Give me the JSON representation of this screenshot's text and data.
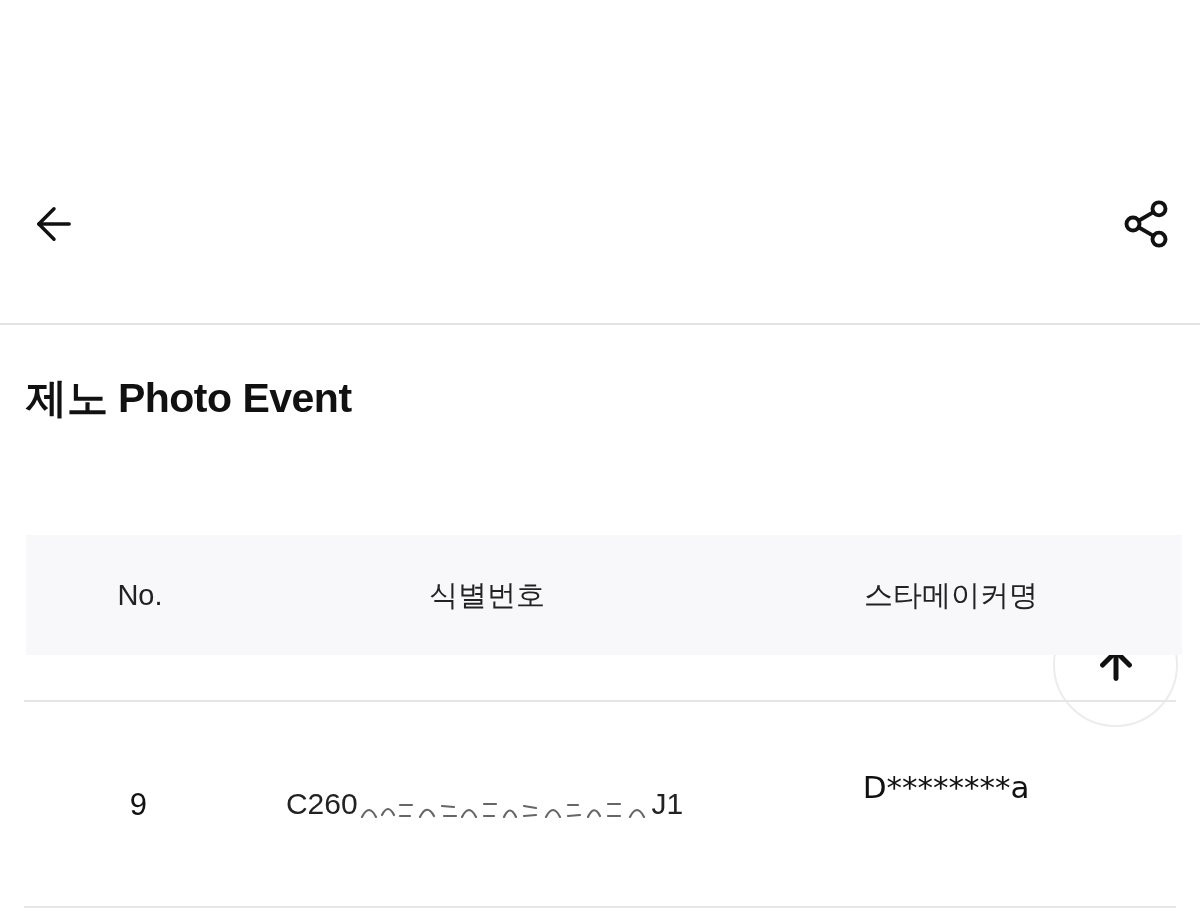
{
  "title": "제노 Photo Event",
  "table": {
    "columns": [
      "No.",
      "식별번호",
      "스타메이커명"
    ],
    "rows": [
      {
        "no": "9",
        "identifier": {
          "visible_start": "C260",
          "visible_end": "J1",
          "redacted": true
        },
        "star_maker": "D********a"
      }
    ]
  }
}
